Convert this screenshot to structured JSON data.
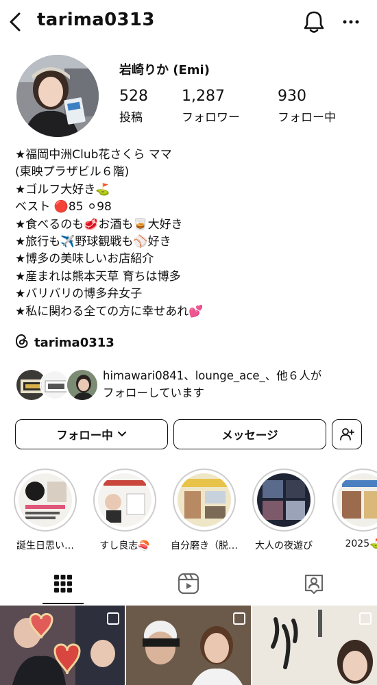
{
  "header": {
    "username": "tarima0313",
    "back_icon": "back-arrow-icon",
    "bell_icon": "bell-icon",
    "more_icon": "more-options-icon"
  },
  "profile": {
    "display_name": "岩崎りか (Emi)",
    "stats": [
      {
        "value": "528",
        "label": "投稿"
      },
      {
        "value": "1,287",
        "label": "フォロワー"
      },
      {
        "value": "930",
        "label": "フォロー中"
      }
    ]
  },
  "bio": {
    "lines": [
      "★福岡中洲Club花さくら ママ",
      "(東映プラザビル６階)",
      "★ゴルフ大好き⛳",
      "ベスト 🔴85 ⚪98",
      "★食べるのも🥩お酒も🥃大好き",
      "★旅行も✈️野球観戦も⚾好き",
      "★博多の美味しいお店紹介",
      "★産まれは熊本天草 育ちは博多",
      "★バリバリの博多弁女子",
      "★私に関わる全ての方に幸せあれ💕"
    ]
  },
  "threads": {
    "icon": "threads-icon",
    "handle": "tarima0313"
  },
  "mutual": {
    "line1": "himawari0841、lounge_ace_、他６人が",
    "line2": "フォローしています"
  },
  "actions": {
    "following_label": "フォロー中",
    "message_label": "メッセージ",
    "add_user_icon": "add-user-icon"
  },
  "highlights": [
    {
      "label": "誕生日思い…"
    },
    {
      "label": "すし良志🍣"
    },
    {
      "label": "自分磨き（脱…"
    },
    {
      "label": "大人の夜遊び"
    },
    {
      "label": "2025⛳"
    }
  ],
  "tabs": [
    {
      "icon": "grid-icon"
    },
    {
      "icon": "reels-icon"
    },
    {
      "icon": "tagged-icon"
    }
  ]
}
